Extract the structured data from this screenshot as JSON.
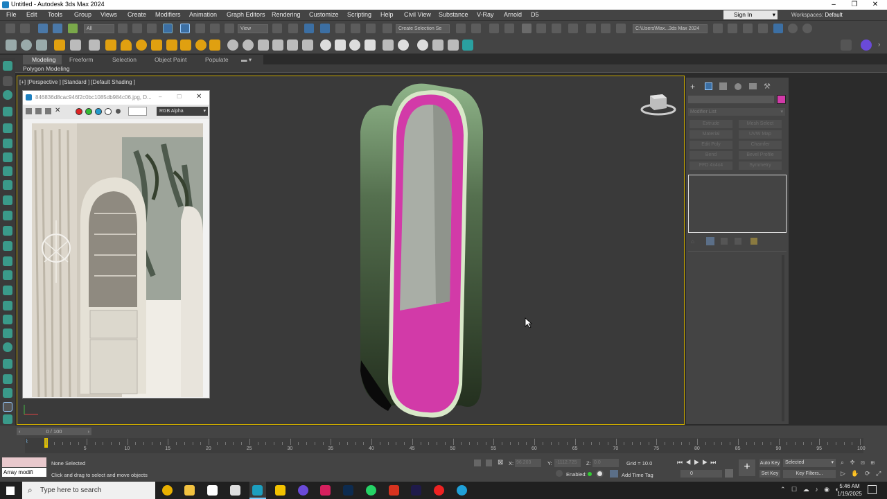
{
  "window": {
    "title": "Untitled - Autodesk 3ds Max 2024"
  },
  "menu": [
    "File",
    "Edit",
    "Tools",
    "Group",
    "Views",
    "Create",
    "Modifiers",
    "Animation",
    "Graph Editors",
    "Rendering",
    "Customize",
    "Scripting",
    "Help",
    "Civil View",
    "Substance",
    "V-Ray",
    "Arnold",
    "D5"
  ],
  "account": {
    "sign_in": "Sign In",
    "workspaces_label": "Workspaces:",
    "workspace": "Default"
  },
  "toolbar": {
    "selection_filter": "All",
    "ref_coord": "View",
    "named_selection": "Create Selection Se",
    "project_path": "C:\\Users\\Max...3ds Max 2024"
  },
  "ribbon": {
    "tabs": [
      "Modeling",
      "Freeform",
      "Selection",
      "Object Paint",
      "Populate"
    ],
    "sub": "Polygon Modeling"
  },
  "viewport": {
    "label": "[+] [Perspective ] [Standard ] [Default Shading ]"
  },
  "image_window": {
    "title": "846836d8cac946f2c0bc1085db984c06.jpg, D...",
    "channel": "RGB Alpha"
  },
  "command_panel": {
    "modifier_list": "Modifier List",
    "buttons": [
      "Extrude",
      "Mesh Select",
      "Material",
      "UVW Map",
      "Edit Poly",
      "Chamfer",
      "Bend",
      "Bevel Profile",
      "FFD 4x4x4",
      "Symmetry"
    ],
    "object_color": "#d23aa8"
  },
  "timeline": {
    "frame_display": "0 / 100",
    "ticks": [
      "0",
      "5",
      "10",
      "15",
      "20",
      "25",
      "30",
      "35",
      "40",
      "45",
      "50",
      "55",
      "60",
      "65",
      "70",
      "75",
      "80",
      "85",
      "90",
      "95",
      "100"
    ]
  },
  "status": {
    "script_listener": "Array modifi",
    "selection": "None Selected",
    "prompt": "Click and drag to select and move objects",
    "x_label": "X:",
    "x_value": "96.203",
    "y_label": "Y:",
    "y_value": "-1112.725",
    "z_label": "Z:",
    "z_value": "0.0",
    "grid": "Grid = 10.0",
    "enabled_label": "Enabled:",
    "add_time_tag": "Add Time Tag",
    "auto_key": "Auto Key",
    "set_key": "Set Key",
    "key_selected": "Selected",
    "key_filters": "Key Filters...",
    "current_frame": "0"
  },
  "taskbar": {
    "search_placeholder": "Type here to search",
    "time": "5:46 AM",
    "date": "1/19/2025"
  },
  "colors": {
    "accent": "#c8a800",
    "magenta": "#d23aa8",
    "ui_bg": "#444444",
    "viewport_bg": "#3a3a3a"
  }
}
